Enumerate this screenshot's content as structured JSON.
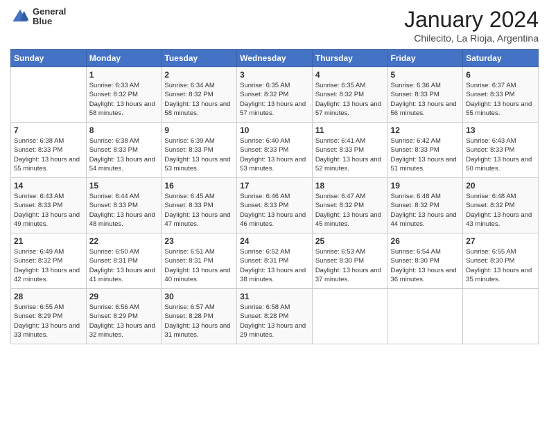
{
  "header": {
    "logo_line1": "General",
    "logo_line2": "Blue",
    "month_year": "January 2024",
    "location": "Chilecito, La Rioja, Argentina"
  },
  "weekdays": [
    "Sunday",
    "Monday",
    "Tuesday",
    "Wednesday",
    "Thursday",
    "Friday",
    "Saturday"
  ],
  "weeks": [
    [
      {
        "day": "",
        "sunrise": "",
        "sunset": "",
        "daylight": ""
      },
      {
        "day": "1",
        "sunrise": "Sunrise: 6:33 AM",
        "sunset": "Sunset: 8:32 PM",
        "daylight": "Daylight: 13 hours and 58 minutes."
      },
      {
        "day": "2",
        "sunrise": "Sunrise: 6:34 AM",
        "sunset": "Sunset: 8:32 PM",
        "daylight": "Daylight: 13 hours and 58 minutes."
      },
      {
        "day": "3",
        "sunrise": "Sunrise: 6:35 AM",
        "sunset": "Sunset: 8:32 PM",
        "daylight": "Daylight: 13 hours and 57 minutes."
      },
      {
        "day": "4",
        "sunrise": "Sunrise: 6:35 AM",
        "sunset": "Sunset: 8:32 PM",
        "daylight": "Daylight: 13 hours and 57 minutes."
      },
      {
        "day": "5",
        "sunrise": "Sunrise: 6:36 AM",
        "sunset": "Sunset: 8:33 PM",
        "daylight": "Daylight: 13 hours and 56 minutes."
      },
      {
        "day": "6",
        "sunrise": "Sunrise: 6:37 AM",
        "sunset": "Sunset: 8:33 PM",
        "daylight": "Daylight: 13 hours and 55 minutes."
      }
    ],
    [
      {
        "day": "7",
        "sunrise": "Sunrise: 6:38 AM",
        "sunset": "Sunset: 8:33 PM",
        "daylight": "Daylight: 13 hours and 55 minutes."
      },
      {
        "day": "8",
        "sunrise": "Sunrise: 6:38 AM",
        "sunset": "Sunset: 8:33 PM",
        "daylight": "Daylight: 13 hours and 54 minutes."
      },
      {
        "day": "9",
        "sunrise": "Sunrise: 6:39 AM",
        "sunset": "Sunset: 8:33 PM",
        "daylight": "Daylight: 13 hours and 53 minutes."
      },
      {
        "day": "10",
        "sunrise": "Sunrise: 6:40 AM",
        "sunset": "Sunset: 8:33 PM",
        "daylight": "Daylight: 13 hours and 53 minutes."
      },
      {
        "day": "11",
        "sunrise": "Sunrise: 6:41 AM",
        "sunset": "Sunset: 8:33 PM",
        "daylight": "Daylight: 13 hours and 52 minutes."
      },
      {
        "day": "12",
        "sunrise": "Sunrise: 6:42 AM",
        "sunset": "Sunset: 8:33 PM",
        "daylight": "Daylight: 13 hours and 51 minutes."
      },
      {
        "day": "13",
        "sunrise": "Sunrise: 6:43 AM",
        "sunset": "Sunset: 8:33 PM",
        "daylight": "Daylight: 13 hours and 50 minutes."
      }
    ],
    [
      {
        "day": "14",
        "sunrise": "Sunrise: 6:43 AM",
        "sunset": "Sunset: 8:33 PM",
        "daylight": "Daylight: 13 hours and 49 minutes."
      },
      {
        "day": "15",
        "sunrise": "Sunrise: 6:44 AM",
        "sunset": "Sunset: 8:33 PM",
        "daylight": "Daylight: 13 hours and 48 minutes."
      },
      {
        "day": "16",
        "sunrise": "Sunrise: 6:45 AM",
        "sunset": "Sunset: 8:33 PM",
        "daylight": "Daylight: 13 hours and 47 minutes."
      },
      {
        "day": "17",
        "sunrise": "Sunrise: 6:46 AM",
        "sunset": "Sunset: 8:33 PM",
        "daylight": "Daylight: 13 hours and 46 minutes."
      },
      {
        "day": "18",
        "sunrise": "Sunrise: 6:47 AM",
        "sunset": "Sunset: 8:32 PM",
        "daylight": "Daylight: 13 hours and 45 minutes."
      },
      {
        "day": "19",
        "sunrise": "Sunrise: 6:48 AM",
        "sunset": "Sunset: 8:32 PM",
        "daylight": "Daylight: 13 hours and 44 minutes."
      },
      {
        "day": "20",
        "sunrise": "Sunrise: 6:48 AM",
        "sunset": "Sunset: 8:32 PM",
        "daylight": "Daylight: 13 hours and 43 minutes."
      }
    ],
    [
      {
        "day": "21",
        "sunrise": "Sunrise: 6:49 AM",
        "sunset": "Sunset: 8:32 PM",
        "daylight": "Daylight: 13 hours and 42 minutes."
      },
      {
        "day": "22",
        "sunrise": "Sunrise: 6:50 AM",
        "sunset": "Sunset: 8:31 PM",
        "daylight": "Daylight: 13 hours and 41 minutes."
      },
      {
        "day": "23",
        "sunrise": "Sunrise: 6:51 AM",
        "sunset": "Sunset: 8:31 PM",
        "daylight": "Daylight: 13 hours and 40 minutes."
      },
      {
        "day": "24",
        "sunrise": "Sunrise: 6:52 AM",
        "sunset": "Sunset: 8:31 PM",
        "daylight": "Daylight: 13 hours and 38 minutes."
      },
      {
        "day": "25",
        "sunrise": "Sunrise: 6:53 AM",
        "sunset": "Sunset: 8:30 PM",
        "daylight": "Daylight: 13 hours and 37 minutes."
      },
      {
        "day": "26",
        "sunrise": "Sunrise: 6:54 AM",
        "sunset": "Sunset: 8:30 PM",
        "daylight": "Daylight: 13 hours and 36 minutes."
      },
      {
        "day": "27",
        "sunrise": "Sunrise: 6:55 AM",
        "sunset": "Sunset: 8:30 PM",
        "daylight": "Daylight: 13 hours and 35 minutes."
      }
    ],
    [
      {
        "day": "28",
        "sunrise": "Sunrise: 6:55 AM",
        "sunset": "Sunset: 8:29 PM",
        "daylight": "Daylight: 13 hours and 33 minutes."
      },
      {
        "day": "29",
        "sunrise": "Sunrise: 6:56 AM",
        "sunset": "Sunset: 8:29 PM",
        "daylight": "Daylight: 13 hours and 32 minutes."
      },
      {
        "day": "30",
        "sunrise": "Sunrise: 6:57 AM",
        "sunset": "Sunset: 8:28 PM",
        "daylight": "Daylight: 13 hours and 31 minutes."
      },
      {
        "day": "31",
        "sunrise": "Sunrise: 6:58 AM",
        "sunset": "Sunset: 8:28 PM",
        "daylight": "Daylight: 13 hours and 29 minutes."
      },
      {
        "day": "",
        "sunrise": "",
        "sunset": "",
        "daylight": ""
      },
      {
        "day": "",
        "sunrise": "",
        "sunset": "",
        "daylight": ""
      },
      {
        "day": "",
        "sunrise": "",
        "sunset": "",
        "daylight": ""
      }
    ]
  ]
}
